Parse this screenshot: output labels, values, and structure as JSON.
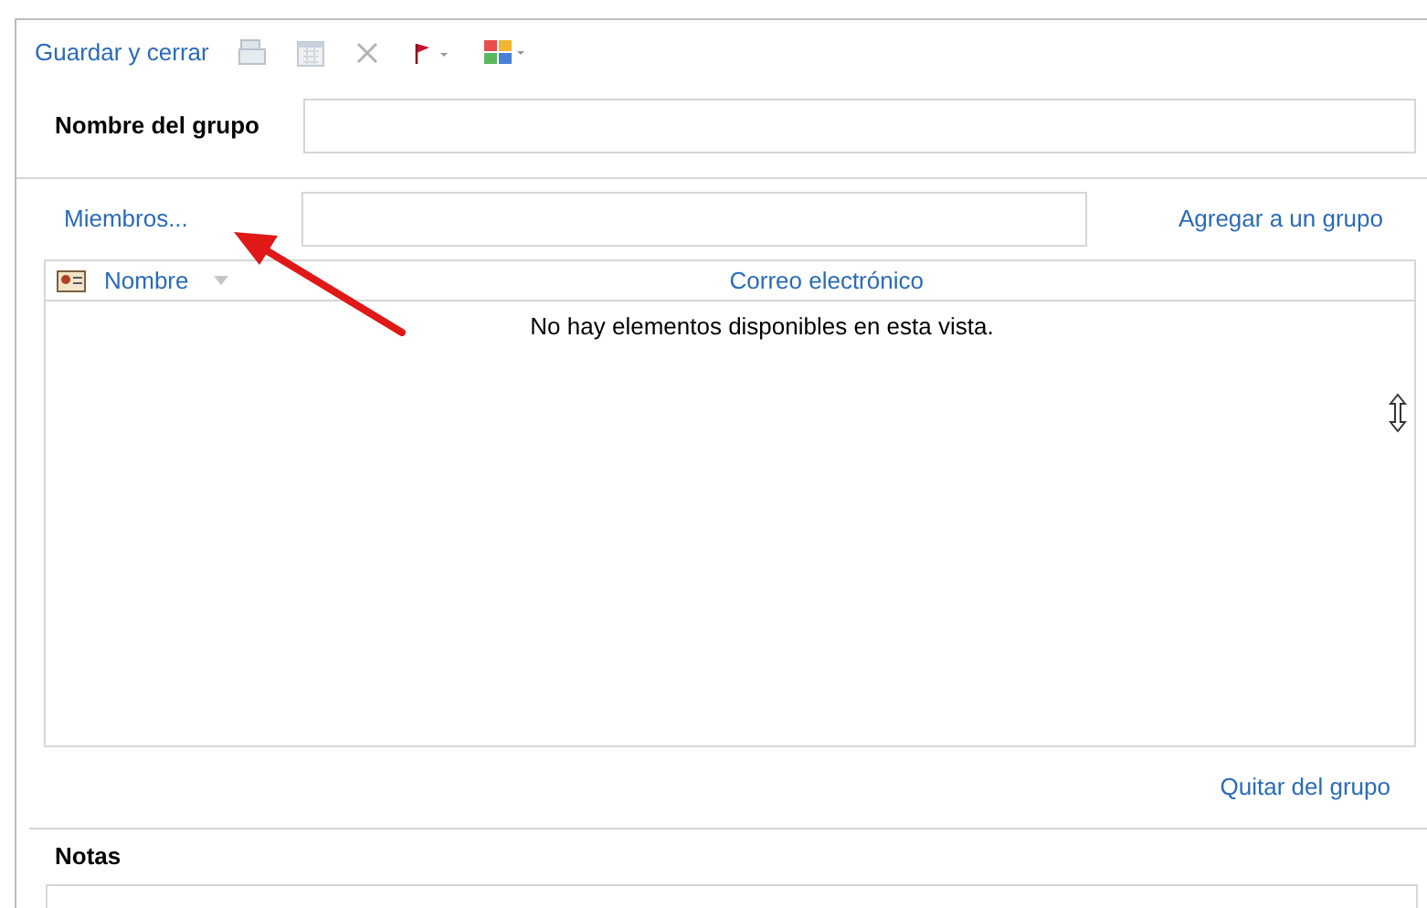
{
  "toolbar": {
    "save_label": "Guardar y cerrar"
  },
  "group_name": {
    "label": "Nombre del grupo"
  },
  "members": {
    "link": "Miembros...",
    "add_link": "Agregar a un grupo"
  },
  "table": {
    "columns": [
      "Nombre",
      "Correo electrónico"
    ],
    "empty_message": "No hay elementos disponibles en esta vista."
  },
  "remove_link": "Quitar del grupo",
  "notes": {
    "label": "Notas"
  }
}
